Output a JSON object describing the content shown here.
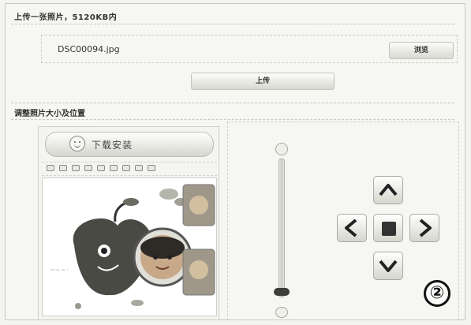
{
  "upload_section": {
    "header": "上传一张照片，5120KB内",
    "file_value": "DSC00094.jpg",
    "browse_label": "浏览",
    "upload_label": "上传"
  },
  "adjust_section": {
    "header": "调整照片大小及位置",
    "install_label": "下载安装"
  },
  "step_badge": "②"
}
